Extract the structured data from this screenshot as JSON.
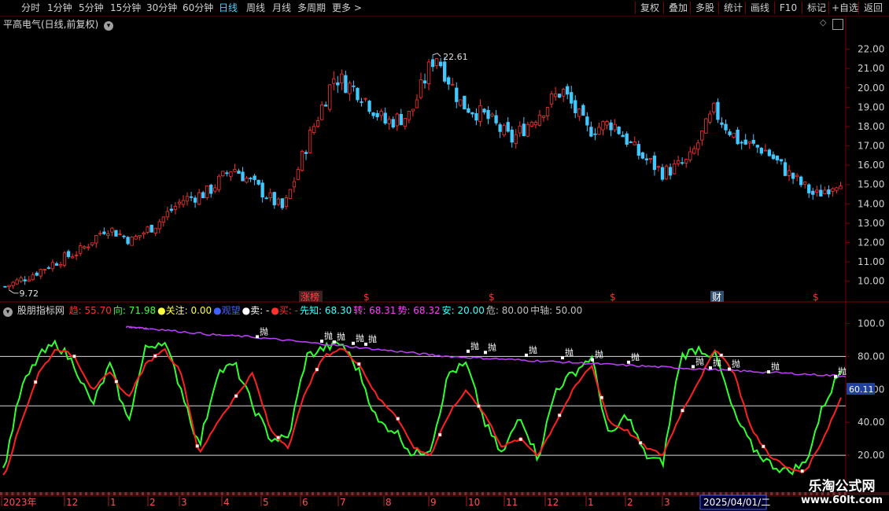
{
  "toolbar": {
    "periods": [
      "分时",
      "1分钟",
      "5分钟",
      "15分钟",
      "30分钟",
      "60分钟",
      "日线",
      "周线",
      "月线",
      "多周期",
      "更多 >"
    ],
    "active_period": "日线",
    "actions": [
      "复权",
      "叠加",
      "多股",
      "统计",
      "画线",
      "F10",
      "标记",
      "+自选",
      "返回"
    ]
  },
  "main_chart": {
    "title": "平高电气(日线,前复权)",
    "high_label": "22.61",
    "low_label": "9.72",
    "y_ticks": [
      "22.00",
      "21.00",
      "20.00",
      "19.00",
      "18.00",
      "17.00",
      "16.00",
      "15.00",
      "14.00",
      "13.00",
      "12.00",
      "11.00",
      "10.00"
    ],
    "markers": [
      {
        "text": "涨榜",
        "color": "#ff4040",
        "bg": "#402020"
      },
      {
        "text": "$",
        "color": "#ff3030"
      },
      {
        "text": "$",
        "color": "#ff3030"
      },
      {
        "text": "$",
        "color": "#ff3030"
      },
      {
        "text": "财",
        "color": "#ffffff",
        "bg": "#305070"
      },
      {
        "text": "$",
        "color": "#ff3030"
      }
    ]
  },
  "indicator": {
    "name": "股朋指标网",
    "legend": [
      {
        "label": "趋:",
        "value": "55.70",
        "color": "#ff3030"
      },
      {
        "label": "向:",
        "value": "71.98",
        "color": "#40ff40"
      },
      {
        "label": "●关注:",
        "value": "0.00",
        "color": "#ffff40"
      },
      {
        "label": "●观望",
        "value": "",
        "color": "#4060ff"
      },
      {
        "label": "●卖:",
        "value": "-",
        "color": "#ffffff"
      },
      {
        "label": "●买:",
        "value": "-",
        "color": "#ff3030"
      },
      {
        "label": "先知:",
        "value": "68.30",
        "color": "#40ffff"
      },
      {
        "label": "转:",
        "value": "68.31",
        "color": "#ff40ff"
      },
      {
        "label": "势:",
        "value": "68.32",
        "color": "#ff40ff"
      },
      {
        "label": "安:",
        "value": "20.00",
        "color": "#40ffff"
      },
      {
        "label": "危:",
        "value": "80.00",
        "color": "#c0c0c0"
      },
      {
        "label": "中轴:",
        "value": "50.00",
        "color": "#c0c0c0"
      }
    ],
    "y_ticks": [
      "100.0",
      "80.00",
      "60.00",
      "40.00",
      "20.00"
    ],
    "current_value": "60.11",
    "sell_label": "抛"
  },
  "x_axis": {
    "labels": [
      "2023年",
      "12",
      "1",
      "2",
      "3",
      "4",
      "5",
      "6",
      "7",
      "8",
      "9",
      "10",
      "11",
      "12",
      "1",
      "2",
      "3"
    ],
    "cursor_date": "2025/04/01/二"
  },
  "watermark": {
    "line1": "乐淘公式网",
    "line2": "www.60lt.com"
  },
  "colors": {
    "up": "#ff3030",
    "down": "#40c8ff",
    "trend": "#ff2020",
    "direction": "#30ff30",
    "line": "#c040ff",
    "grid": "#7a0000"
  },
  "chart_data": {
    "type": "line",
    "title": "平高电气(日线,前复权)",
    "x": [
      "2023年",
      "12",
      "1",
      "2",
      "3",
      "4",
      "5",
      "6",
      "7",
      "8",
      "9",
      "10",
      "11",
      "12",
      "1",
      "2",
      "3"
    ],
    "price_close": [
      9.72,
      10.3,
      11.0,
      11.6,
      12.8,
      12.1,
      13.0,
      14.2,
      14.6,
      15.9,
      14.8,
      13.7,
      17.4,
      20.6,
      19.8,
      18.2,
      18.6,
      21.8,
      19.2,
      18.5,
      17.3,
      18.6,
      19.9,
      17.8,
      18.2,
      16.6,
      15.6,
      16.2,
      18.8,
      17.2,
      16.8,
      15.5,
      14.4,
      15.3
    ],
    "series": [
      {
        "name": "趋",
        "values": [
          5,
          40,
          70,
          85,
          80,
          60,
          70,
          55,
          75,
          85,
          70,
          20,
          40,
          55,
          70,
          35,
          25,
          60,
          80,
          85,
          75,
          55,
          45,
          25,
          20,
          45,
          60,
          45,
          25,
          30,
          20,
          40,
          60,
          75,
          40,
          35,
          25,
          20,
          45,
          65,
          85,
          70,
          35,
          20,
          12,
          10,
          30,
          55
        ]
      },
      {
        "name": "向",
        "values": [
          10,
          60,
          80,
          88,
          75,
          50,
          75,
          40,
          85,
          90,
          60,
          25,
          70,
          75,
          50,
          30,
          30,
          80,
          85,
          88,
          70,
          40,
          35,
          20,
          25,
          70,
          75,
          40,
          20,
          45,
          18,
          60,
          70,
          80,
          30,
          45,
          20,
          15,
          80,
          85,
          80,
          45,
          25,
          15,
          10,
          15,
          50,
          72
        ]
      },
      {
        "name": "转",
        "values": [
          97,
          95,
          93,
          92,
          90,
          88,
          86,
          84,
          82,
          80,
          79,
          78,
          77,
          76,
          75,
          74,
          73,
          72,
          71,
          70,
          69,
          68
        ]
      }
    ],
    "ylim_price": [
      9.5,
      23
    ],
    "ylim_indicator": [
      0,
      105
    ]
  }
}
